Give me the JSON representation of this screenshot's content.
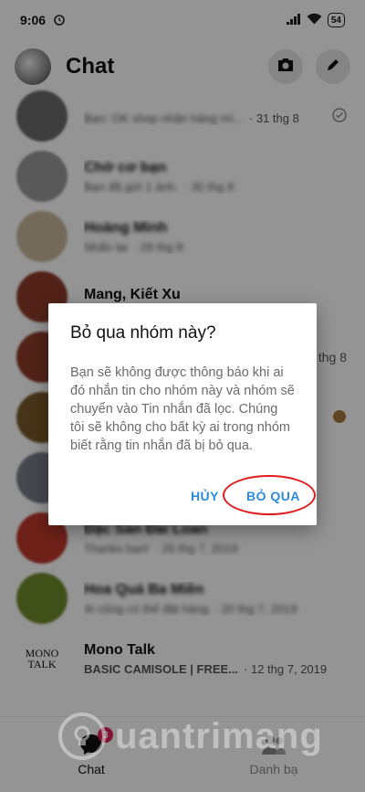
{
  "status_bar": {
    "time": "9:06",
    "battery": "54"
  },
  "header": {
    "title": "Chat",
    "camera_icon": "camera-icon",
    "compose_icon": "pencil-icon"
  },
  "conversations": [
    {
      "name": "",
      "snippet": "Bạn: OK shop nhận hàng mì...",
      "time": "· 31 thg 8",
      "avatar_color": "#6b6b6b"
    },
    {
      "name": "Chờ cơ bạn",
      "snippet": "Bạn đã gửi 1 ảnh.",
      "time": "· 30 thg 8",
      "avatar_color": "#9a9a9a"
    },
    {
      "name": "Hoàng Minh",
      "snippet": "Nhắn lại",
      "time": "· 29 thg 8",
      "avatar_color": "#c9b79c"
    },
    {
      "name": "Mang, Kiết Xu",
      "snippet": "",
      "time": "",
      "avatar_color": "#8e3b2a"
    },
    {
      "name": "",
      "snippet": "",
      "time": "thg 8",
      "avatar_color": "#8e3b2a"
    },
    {
      "name": "",
      "snippet": "",
      "time": "",
      "avatar_color": "#7a5a2a"
    },
    {
      "name": "",
      "snippet": "",
      "time": "",
      "avatar_color": "#7a7a8a"
    },
    {
      "name": "Đặc Sản Đài Loan",
      "snippet": "Thanks bạn!",
      "time": "· 26 thg 7, 2019",
      "avatar_color": "#c0392b"
    },
    {
      "name": "Hoa Quả Ba Miền",
      "snippet": "Ai cũng có thể đặt hàng",
      "time": "· 20 thg 7, 2019",
      "avatar_color": "#6e8b2c"
    },
    {
      "name": "Mono Talk",
      "snippet": "BASIC CAMISOLE | FREE...",
      "time": "· 12 thg 7, 2019",
      "avatar_color": "#ffffff",
      "avatar_text": "MONO TALK"
    }
  ],
  "dialog": {
    "title": "Bỏ qua nhóm này?",
    "body": "Bạn sẽ không được thông báo khi ai đó nhắn tin cho nhóm này và nhóm sẽ chuyển vào Tin nhắn đã lọc. Chúng tôi sẽ không cho bất kỳ ai trong nhóm biết rằng tin nhắn đã bị bỏ qua.",
    "cancel_label": "HỦY",
    "confirm_label": "BỎ QUA"
  },
  "tabs": {
    "chat_label": "Chat",
    "chat_badge": "3",
    "contacts_label": "Danh bạ"
  },
  "watermark": "uantrimang",
  "colors": {
    "accent": "#2b8ae0",
    "highlight": "#e01b1b",
    "badge": "#e0245e"
  }
}
